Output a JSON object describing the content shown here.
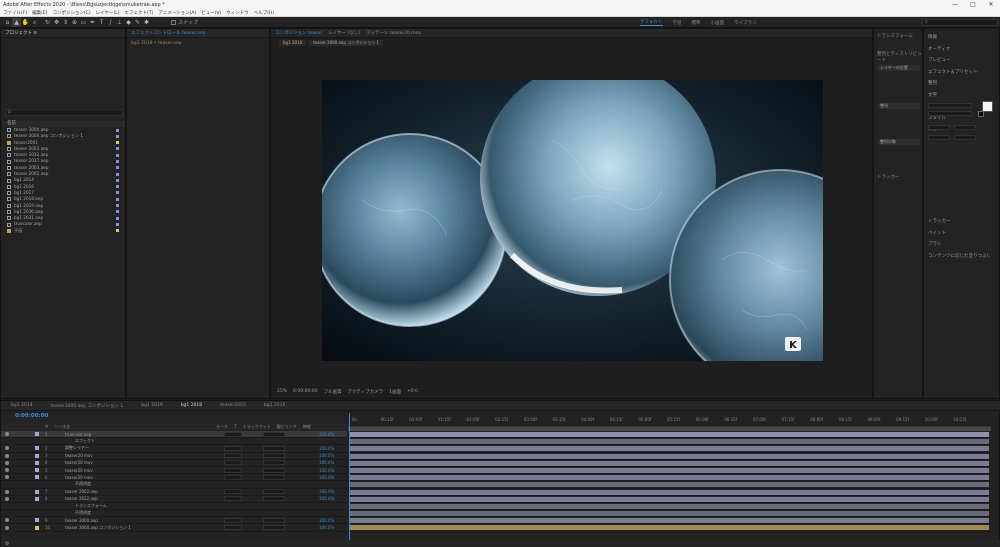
{
  "window": {
    "title": "Adobe After Effects 2020 - \\Bless\\Bgsuzjectkjge\\smuketrae.aep *",
    "controls": [
      "—",
      "□",
      "✕"
    ]
  },
  "menu": [
    "ファイル(F)",
    "編集(E)",
    "コンポジション(C)",
    "レイヤー(L)",
    "エフェクト(T)",
    "アニメーション(A)",
    "ビュー(V)",
    "ウィンドウ",
    "ヘルプ(H)"
  ],
  "toolbar": {
    "tools": [
      "home-icon",
      "selection-icon",
      "hand-icon",
      "zoom-icon",
      "orbit-icon",
      "pan-icon",
      "dolly-icon",
      "pan-behind-icon",
      "rectangle-icon",
      "pen-icon",
      "type-icon",
      "brush-icon",
      "clone-icon",
      "eraser-icon",
      "roto-icon",
      "puppet-icon"
    ],
    "snap_label": "スナップ",
    "workspaces": [
      "デフォルト",
      "学習",
      "標準",
      "小画面",
      "ライブラリ"
    ],
    "search_placeholder": "ヘルプを検索"
  },
  "project_panel": {
    "tab": "プロジェクト ≡",
    "search_placeholder": "ρ",
    "column": "名前",
    "items": [
      {
        "name": "teaser 3000.aep",
        "type": "comp",
        "tag": "#8a8fd6"
      },
      {
        "name": "teaser 3000.aep コンポジション 1",
        "type": "comp",
        "tag": "#8a8fd6"
      },
      {
        "name": "teaser2001",
        "type": "folder",
        "tag": "#e3c262"
      },
      {
        "name": "teaser 2003.aep",
        "type": "comp",
        "tag": "#8a8fd6"
      },
      {
        "name": "teaser 2032.aep",
        "type": "comp",
        "tag": "#8a8fd6"
      },
      {
        "name": "teaser 2037.aep",
        "type": "comp",
        "tag": "#8a8fd6"
      },
      {
        "name": "teaser 2003.aep",
        "type": "comp",
        "tag": "#8a8fd6"
      },
      {
        "name": "teaser 2002.aep",
        "type": "comp",
        "tag": "#8a8fd6"
      },
      {
        "name": "bg1 2014",
        "type": "footage",
        "tag": "#8a8fd6"
      },
      {
        "name": "bg1 2016",
        "type": "footage",
        "tag": "#8a8fd6"
      },
      {
        "name": "bg1 2017",
        "type": "footage",
        "tag": "#8a8fd6"
      },
      {
        "name": "bg1 2018.aep",
        "type": "footage",
        "tag": "#8a8fd6"
      },
      {
        "name": "bg1 2019.aep",
        "type": "footage",
        "tag": "#8a8fd6"
      },
      {
        "name": "bg1 2030.aep",
        "type": "footage",
        "tag": "#8a8fd6"
      },
      {
        "name": "bg1 2031.aep",
        "type": "footage",
        "tag": "#8a8fd6"
      },
      {
        "name": "truecolor.aep",
        "type": "footage",
        "tag": "#8a8fd6"
      },
      {
        "name": "平面",
        "type": "folder",
        "tag": "#e3c262"
      }
    ]
  },
  "effects_panel": {
    "tab": "エフェクトコントロール teaser.aep",
    "path": "bg1 2019 • teaser.aep"
  },
  "composition_panel": {
    "tabs": [
      "コンポジション teaser",
      "レイヤー (なし)",
      "フッテージ teaser20.mov"
    ],
    "sub_tabs": [
      "bg1 2018",
      "teaser 3000.aep コンポジション 1"
    ],
    "logo_mark": "K",
    "viewer_bar": [
      "25%",
      "0:00:00:00",
      "フル画質",
      "アクティブカメラ",
      "1画面",
      "+0.0"
    ]
  },
  "properties_panel": {
    "sections": [
      "トランスフォーム",
      "整列とディストリビュート",
      "トラッカー"
    ],
    "buttons": [
      "レイヤーの位置",
      "整列",
      "整列対象"
    ]
  },
  "character_panel": {
    "items": [
      "情報",
      "オーディオ",
      "プレビュー",
      "エフェクト＆プリセット",
      "整列",
      "文字",
      "フォント",
      "スタイル",
      "段落",
      "",
      "",
      "",
      "",
      "",
      "",
      "",
      "トラッカー",
      "ペイント",
      "ブラシ",
      "コンテンツに応じた塗りつぶし"
    ],
    "fill_color": "#f4f4f4",
    "stroke_color": "#000000"
  },
  "timeline": {
    "tabs": [
      "bg1 2014",
      "teaser3000.aep コンポジション 1",
      "bg1 2019",
      "bg1 2018",
      "teaser2003",
      "bg1 2016"
    ],
    "active_tab": 3,
    "timecode": "0:00:00:00",
    "columns": [
      "#",
      "ソース名",
      "モード",
      "T",
      "トラックマット",
      "親とリンク",
      "伸縮"
    ],
    "ruler_ticks": [
      "0s",
      "00:15f",
      "01:00f",
      "01:15f",
      "02:00f",
      "02:15f",
      "03:00f",
      "03:15f",
      "04:00f",
      "04:15f",
      "05:00f",
      "05:15f",
      "06:00f",
      "06:15f",
      "07:00f",
      "07:15f",
      "08:00f",
      "08:15f",
      "09:00f",
      "09:15f",
      "10:00f",
      "10:15f"
    ],
    "layers": [
      {
        "num": "1",
        "name": "truecolor.aep",
        "label": "#a8a8d8",
        "bar": "#8f8fb0",
        "selected": true
      },
      {
        "num": "",
        "name": "エフェクト",
        "label": "",
        "bar": "#6b6b7e"
      },
      {
        "num": "2",
        "name": "調整レイヤー",
        "label": "#a8a8d8",
        "bar": "#7b7b94"
      },
      {
        "num": "3",
        "name": "teaser20 mov",
        "label": "#a8a8d8",
        "bar": "#7b7b94"
      },
      {
        "num": "4",
        "name": "teaser20 mov",
        "label": "#a8a8d8",
        "bar": "#7b7b94"
      },
      {
        "num": "5",
        "name": "teaser20 mov",
        "label": "#a8a8d8",
        "bar": "#7b7b94"
      },
      {
        "num": "6",
        "name": "teaser20 mov",
        "label": "#a8a8d8",
        "bar": "#7b7b94"
      },
      {
        "num": "",
        "name": "不透明度",
        "label": "",
        "bar": "#6b6b7e"
      },
      {
        "num": "7",
        "name": "teaser 2002.aep",
        "label": "#a8a8d8",
        "bar": "#7b7b94"
      },
      {
        "num": "8",
        "name": "teaser 2032.aep",
        "label": "#a8a8d8",
        "bar": "#7b7b94"
      },
      {
        "num": "",
        "name": "トランスフォーム",
        "label": "",
        "bar": "#6b6b7e"
      },
      {
        "num": "",
        "name": "不透明度",
        "label": "",
        "bar": "#6b6b7e"
      },
      {
        "num": "9",
        "name": "teaser 3000.aep",
        "label": "#a8a8d8",
        "bar": "#7b7b94"
      },
      {
        "num": "10",
        "name": "teaser 3000.aep コンポジション 1",
        "label": "#e3c262",
        "bar": "#9c8a55"
      }
    ],
    "stretch_value": "100.0%"
  }
}
